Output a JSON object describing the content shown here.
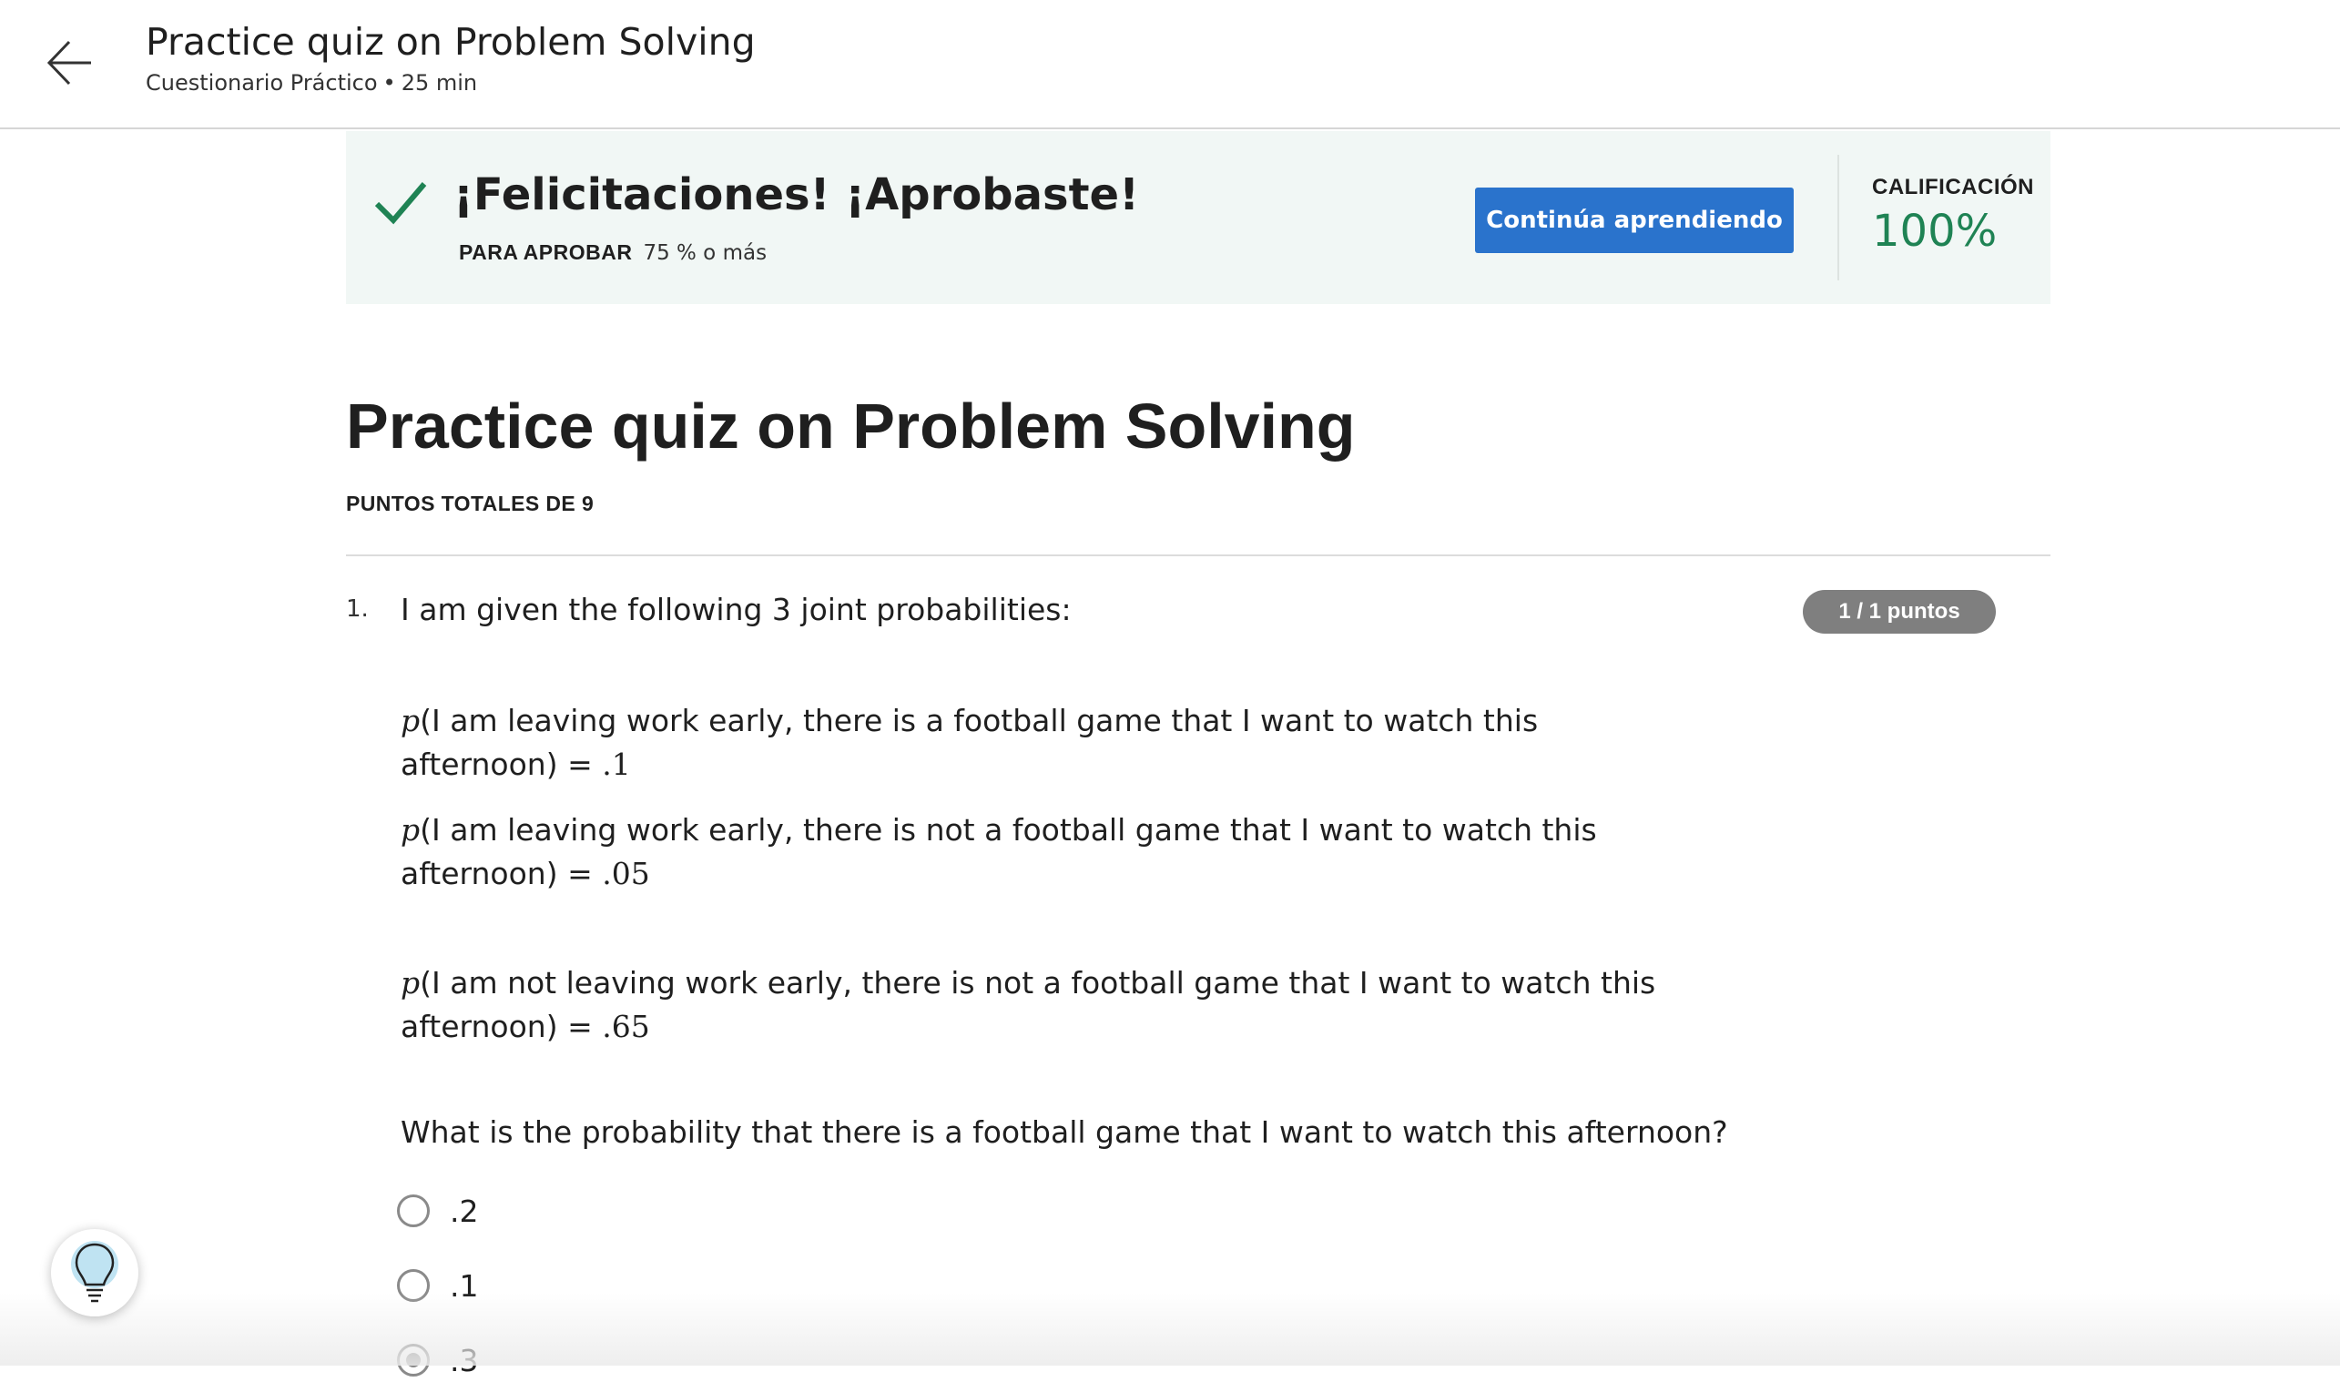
{
  "header": {
    "title": "Practice quiz on Problem Solving",
    "subtitle_type": "Cuestionario Práctico",
    "subtitle_separator": "•",
    "subtitle_duration": "25 min"
  },
  "banner": {
    "title": "¡Felicitaciones! ¡Aprobaste!",
    "pass_label": "PARA APROBAR",
    "pass_value": "75 % o más",
    "continue_label": "Continúa aprendiendo",
    "grade_label": "CALIFICACIÓN",
    "grade_value": "100%"
  },
  "quiz": {
    "title": "Practice quiz on Problem Solving",
    "total_points": "PUNTOS TOTALES DE 9"
  },
  "question1": {
    "number": "1.",
    "intro": "I am given the following 3 joint probabilities:",
    "points_badge": "1 / 1 puntos",
    "probabilities": [
      {
        "p": "p",
        "text": "(I am leaving work early, there is a football game that I want to watch this afternoon) = ",
        "value": ".1"
      },
      {
        "p": "p",
        "text": "(I am leaving work early, there is not a football game that I want to watch this afternoon) = ",
        "value": ".05"
      },
      {
        "p": "p",
        "text": "(I am not leaving work early, there is not a football game that I want to watch this afternoon) = ",
        "value": ".65"
      }
    ],
    "question": "What is the probability that there is a football game that I want to watch this afternoon?",
    "options": [
      {
        "label": ".2",
        "selected": false
      },
      {
        "label": ".1",
        "selected": false
      },
      {
        "label": ".3",
        "selected": true
      }
    ]
  },
  "colors": {
    "accent_button": "#2a73cc",
    "success_green": "#1f8354",
    "banner_bg": "#f1f7f5",
    "badge_grey": "#7f7f7f"
  },
  "icons": {
    "back": "arrow-left-icon",
    "check": "check-icon",
    "hint": "lightbulb-icon"
  }
}
